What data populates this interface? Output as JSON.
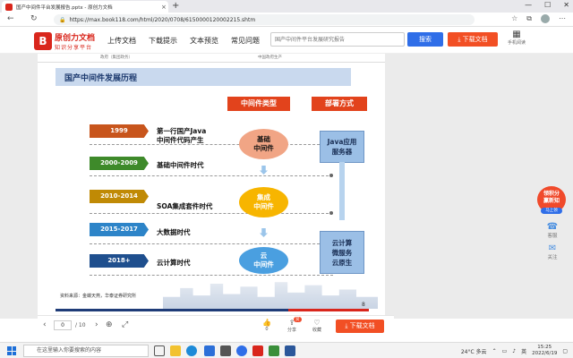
{
  "browser": {
    "tab_title": "国产中间件平台发展报告.pptx - 原创力文档",
    "tab_close": "×",
    "new_tab": "+",
    "url": "https://max.book118.com/html/2020/0708/6150000120002215.shtm",
    "win_controls": [
      "—",
      "☐",
      "✕"
    ],
    "nav": [
      "←",
      "↻"
    ]
  },
  "site": {
    "logo_mark": "B",
    "logo_main": "原创力文档",
    "logo_sub": "知识分享平台",
    "nav": [
      "上传文档",
      "下载提示",
      "文本预览",
      "常见问题"
    ],
    "search_placeholder": "国产中间件平台发展研究报告",
    "search_label": "搜索",
    "download_label": "下载文档",
    "mobile_label": "手机阅读"
  },
  "doc": {
    "prev_strip": [
      "政府（集团政务）",
      "中国政府生产"
    ],
    "slide_title": "国产中间件发展历程",
    "col_head_type": "中间件类型",
    "col_head_deploy": "部署方式",
    "timeline": [
      {
        "year": "1999",
        "era": "第一行国产Java\n中间件代码产生",
        "color": "#c8551c"
      },
      {
        "year": "2000-2009",
        "era": "基础中间件时代",
        "color": "#3e8a2a"
      },
      {
        "year": "2010-2014",
        "era": "SOA集成套件时代",
        "color": "#c08a05"
      },
      {
        "year": "2015-2017",
        "era": "大数据时代",
        "color": "#2d84c8"
      },
      {
        "year": "2018+",
        "era": "云计算时代",
        "color": "#1f4f8e"
      }
    ],
    "types": [
      "基础\n中间件",
      "集成\n中间件",
      "云\n中间件"
    ],
    "deploy": [
      "Java应用\n服务器",
      "云计算\n微服务\n云原生"
    ],
    "source": "资料来源：金蝶天燕，华泰证券研究所",
    "page_number": "8"
  },
  "promo": {
    "text": "领积分\n赢新知",
    "pill": "马上领"
  },
  "side_widgets": [
    {
      "icon": "headset-icon",
      "glyph": "☎",
      "label": "客服"
    },
    {
      "icon": "chat-icon",
      "glyph": "✉",
      "label": "关注"
    }
  ],
  "viewer": {
    "prev": "‹",
    "page_current": "0",
    "page_total": "/ 10",
    "next": "›",
    "zoom_in": "⊕",
    "fullscreen": "⤢",
    "like_count": "0",
    "share_label": "分享",
    "share_badge": "赏",
    "collect_label": "收藏",
    "download_label": "下载文档"
  },
  "taskbar": {
    "search_placeholder": "在这里输入你要搜索的内容",
    "weather": "24°C 多云",
    "lang": "英",
    "time": "15:25",
    "date": "2022/6/19"
  },
  "colors": {
    "brand_red": "#d9261c",
    "search_blue": "#2f6ee8",
    "download_orange": "#f24f24",
    "col_head_red": "#e2431c"
  }
}
